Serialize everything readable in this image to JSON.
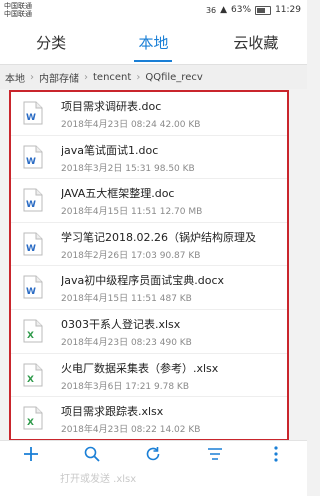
{
  "status_bar": {
    "carrier_1": "中国联通",
    "carrier_2": "中国联通",
    "network": "36",
    "battery": "63%",
    "time": "11:29"
  },
  "tabs": [
    {
      "label": "分类",
      "active": false
    },
    {
      "label": "本地",
      "active": true
    },
    {
      "label": "云收藏",
      "active": false
    }
  ],
  "breadcrumb": [
    "本地",
    "内部存储",
    "tencent",
    "QQfile_recv"
  ],
  "files": [
    {
      "name": "项目需求调研表.doc",
      "meta": "2018年4月23日 08:24 42.00 KB",
      "type": "word"
    },
    {
      "name": "java笔试面试1.doc",
      "meta": "2018年3月2日 15:31 98.50 KB",
      "type": "word"
    },
    {
      "name": "JAVA五大框架整理.doc",
      "meta": "2018年4月15日 11:51 12.70 MB",
      "type": "word"
    },
    {
      "name": "学习笔记2018.02.26（锅炉结构原理及",
      "meta": "2018年2月26日 17:03 90.87 KB",
      "type": "word"
    },
    {
      "name": "Java初中级程序员面试宝典.docx",
      "meta": "2018年4月15日 11:51 487 KB",
      "type": "word"
    },
    {
      "name": "0303干系人登记表.xlsx",
      "meta": "2018年4月23日 08:23 490 KB",
      "type": "excel"
    },
    {
      "name": "火电厂数据采集表（参考）.xlsx",
      "meta": "2018年3月6日 17:21 9.78 KB",
      "type": "excel"
    },
    {
      "name": "项目需求跟踪表.xlsx",
      "meta": "2018年4月23日 08:22 14.02 KB",
      "type": "excel"
    }
  ],
  "toolbar": {
    "ghost_text": "打开或发送 .xlsx"
  },
  "colors": {
    "accent": "#1a7fd6",
    "highlight_border": "#c9252c",
    "word_icon": "#2b6cc4",
    "excel_icon": "#2e9a4a"
  }
}
